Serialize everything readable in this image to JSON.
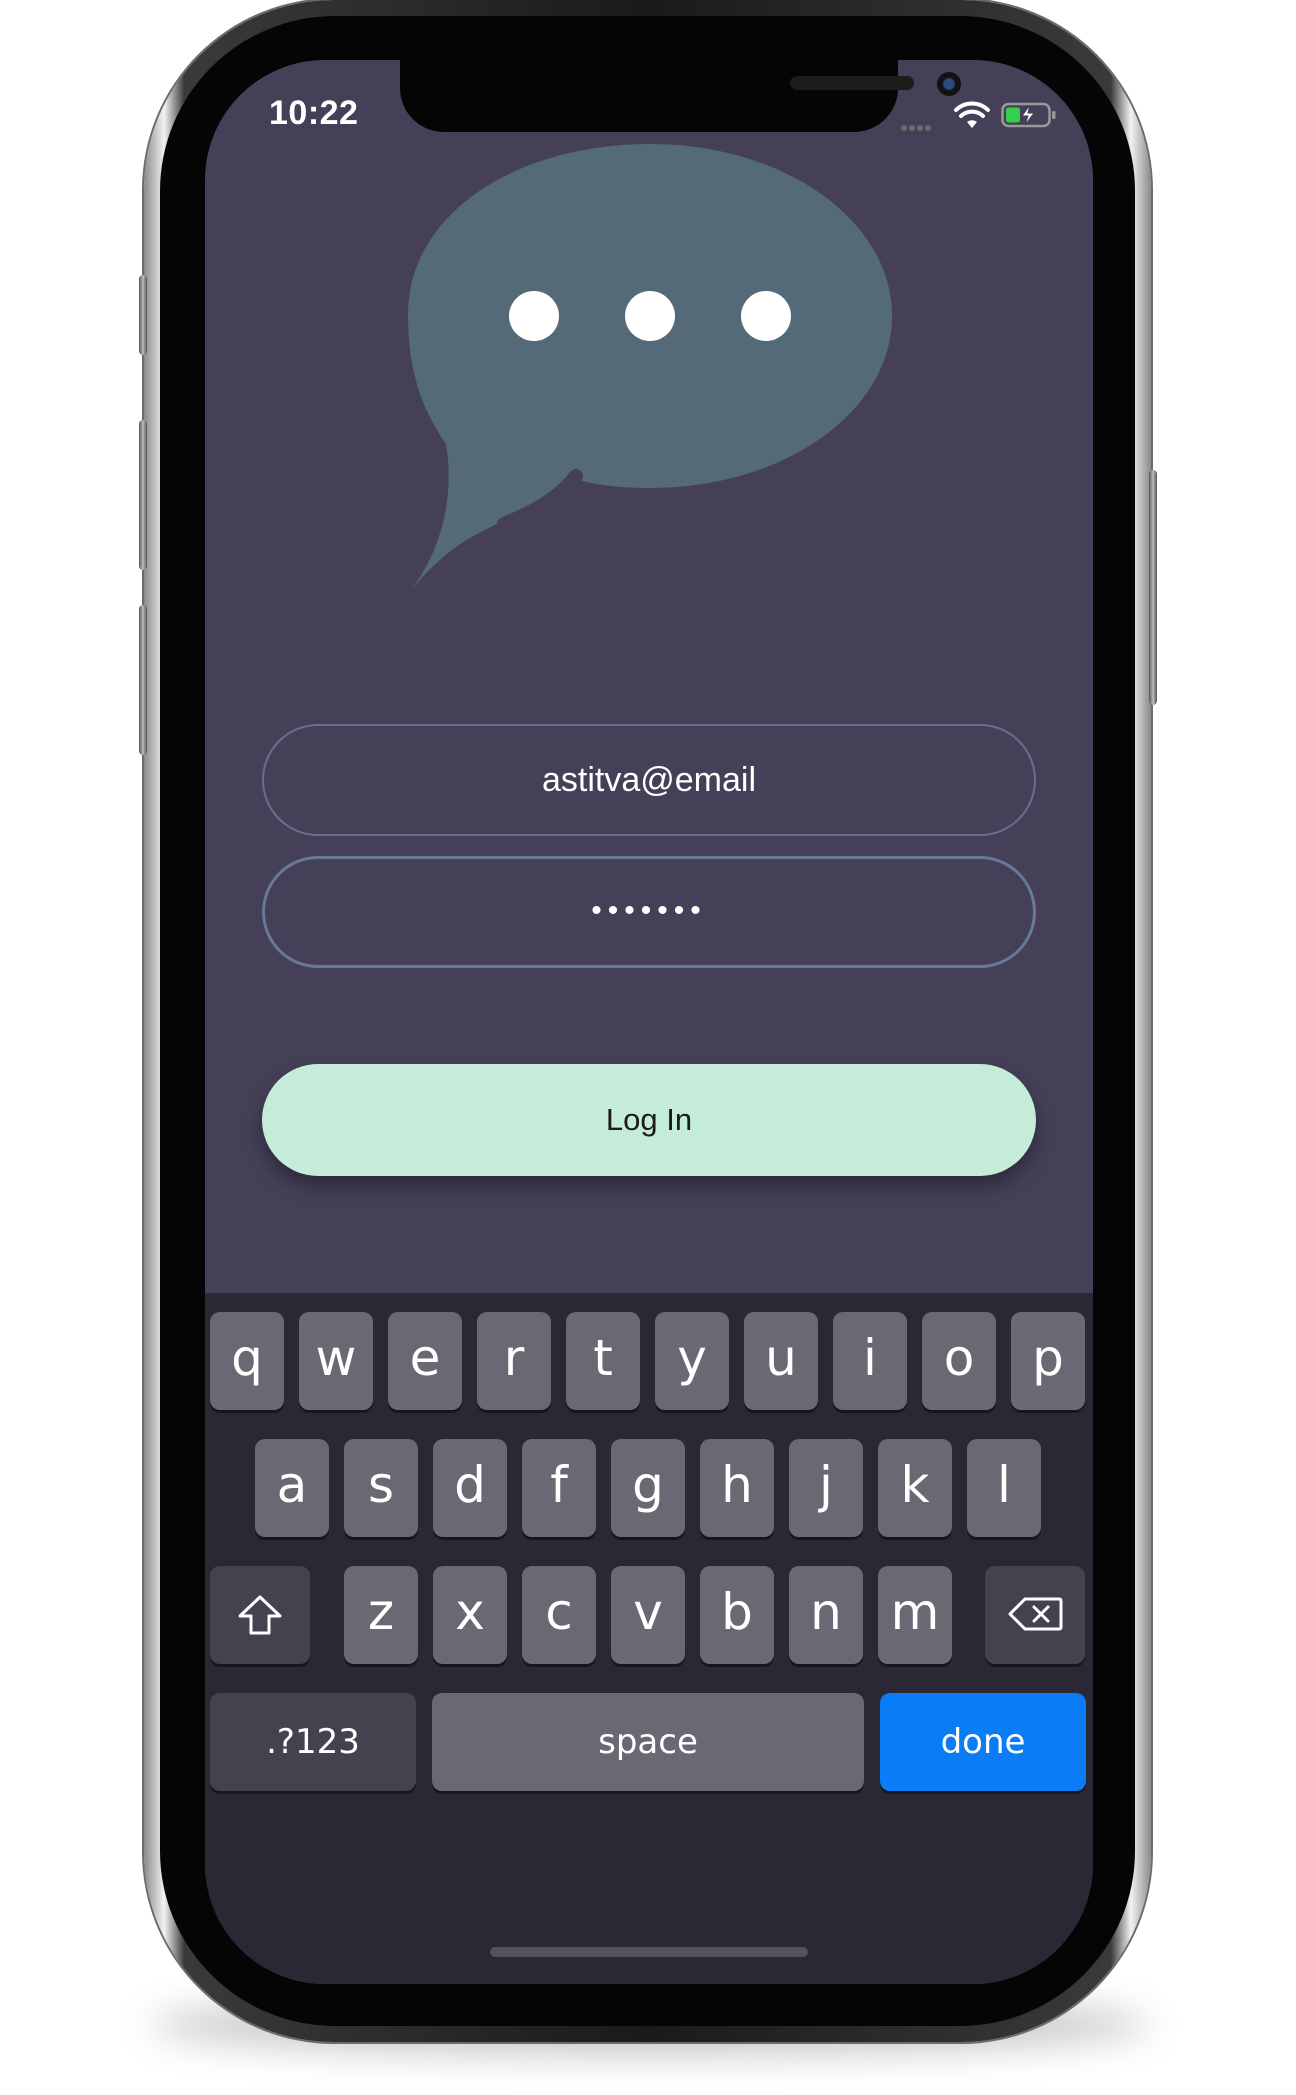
{
  "status_bar": {
    "time": "10:22",
    "wifi_icon": "wifi-icon",
    "battery_icon": "battery-charging-icon",
    "signal_icon": "cellular-signal-icon"
  },
  "logo": {
    "icon": "chat-bubble-ellipsis-icon",
    "color": "#546a78"
  },
  "form": {
    "email_value": "astitva@email",
    "password_value": "•••••••",
    "login_label": "Log In"
  },
  "keyboard": {
    "row1": [
      "q",
      "w",
      "e",
      "r",
      "t",
      "y",
      "u",
      "i",
      "o",
      "p"
    ],
    "row2": [
      "a",
      "s",
      "d",
      "f",
      "g",
      "h",
      "j",
      "k",
      "l"
    ],
    "row3": [
      "z",
      "x",
      "c",
      "v",
      "b",
      "n",
      "m"
    ],
    "numbers_label": ".?123",
    "space_label": "space",
    "done_label": "done",
    "shift_icon": "shift-icon",
    "delete_icon": "backspace-icon"
  },
  "colors": {
    "background": "#453f58",
    "accent_button": "#c4ecd9",
    "done_key": "#0a7cf6",
    "keyboard": "#2b2836"
  }
}
